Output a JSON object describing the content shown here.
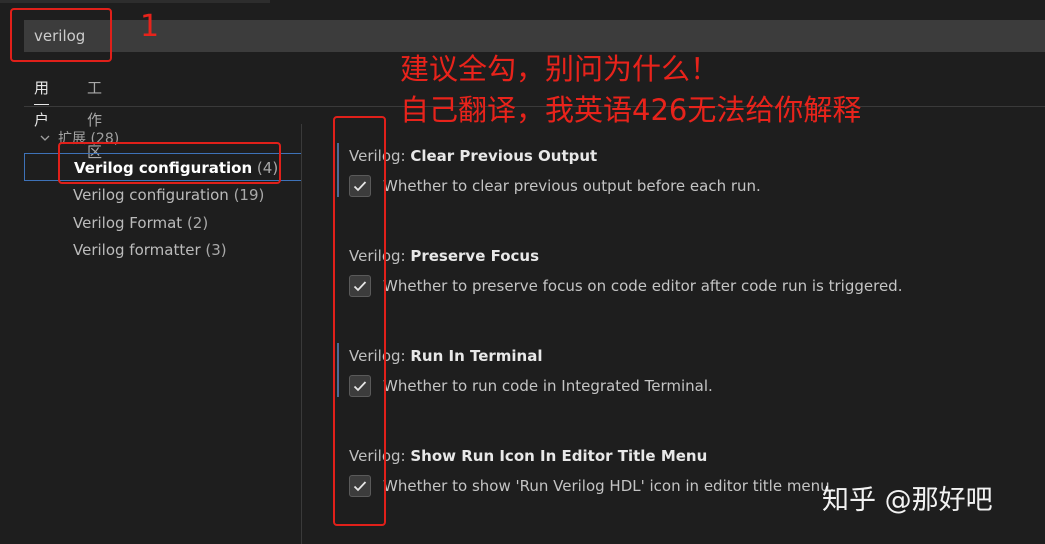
{
  "search": {
    "value": "verilog"
  },
  "tabs": [
    {
      "label": "用户",
      "active": true
    },
    {
      "label": "工作区",
      "active": false
    }
  ],
  "tree": {
    "group": {
      "label": "扩展",
      "count": "(28)"
    },
    "items": [
      {
        "name": "Verilog configuration",
        "count": "(4)",
        "selected": true
      },
      {
        "name": "Verilog configuration",
        "count": "(19)",
        "selected": false
      },
      {
        "name": "Verilog Format",
        "count": "(2)",
        "selected": false
      },
      {
        "name": "Verilog formatter",
        "count": "(3)",
        "selected": false
      }
    ]
  },
  "settings": [
    {
      "category": "Verilog: ",
      "name": "Clear Previous Output",
      "description": "Whether to clear previous output before each run.",
      "checked": true
    },
    {
      "category": "Verilog: ",
      "name": "Preserve Focus",
      "description": "Whether to preserve focus on code editor after code run is triggered.",
      "checked": true
    },
    {
      "category": "Verilog: ",
      "name": "Run In Terminal",
      "description": "Whether to run code in Integrated Terminal.",
      "checked": true
    },
    {
      "category": "Verilog: ",
      "name": "Show Run Icon In Editor Title Menu",
      "description": "Whether to show 'Run Verilog HDL' icon in editor title menu.",
      "checked": true
    }
  ],
  "annotations": {
    "mark": "1",
    "line1": "建议全勾，别问为什么！",
    "line2": "自己翻译，我英语426无法给你解释",
    "color": "#e0201a"
  },
  "watermark": "知乎 @那好吧",
  "colors": {
    "background": "#1e1e1e",
    "input": "#3c3c3c",
    "selection_border": "#3e72b8"
  }
}
